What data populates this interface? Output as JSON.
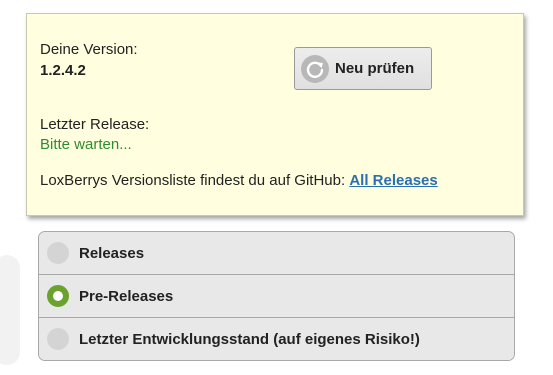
{
  "version": {
    "label": "Deine Version:",
    "value": "1.2.4.2"
  },
  "check_button": {
    "label": "Neu prüfen",
    "icon": "refresh-icon"
  },
  "release": {
    "label": "Letzter Release:",
    "status": "Bitte warten..."
  },
  "github": {
    "text": "LoxBerrys Versionsliste findest du auf GitHub: ",
    "link_label": "All Releases"
  },
  "channels": {
    "options": [
      {
        "label": "Releases",
        "selected": false
      },
      {
        "label": "Pre-Releases",
        "selected": true
      },
      {
        "label": "Letzter Entwicklungsstand (auf eigenes Risiko!)",
        "selected": false
      }
    ]
  },
  "colors": {
    "panel_background": "#ffffe0",
    "status_green": "#2e8b2e",
    "link_blue": "#2a6fb0",
    "radio_selected": "#6aa22e"
  }
}
